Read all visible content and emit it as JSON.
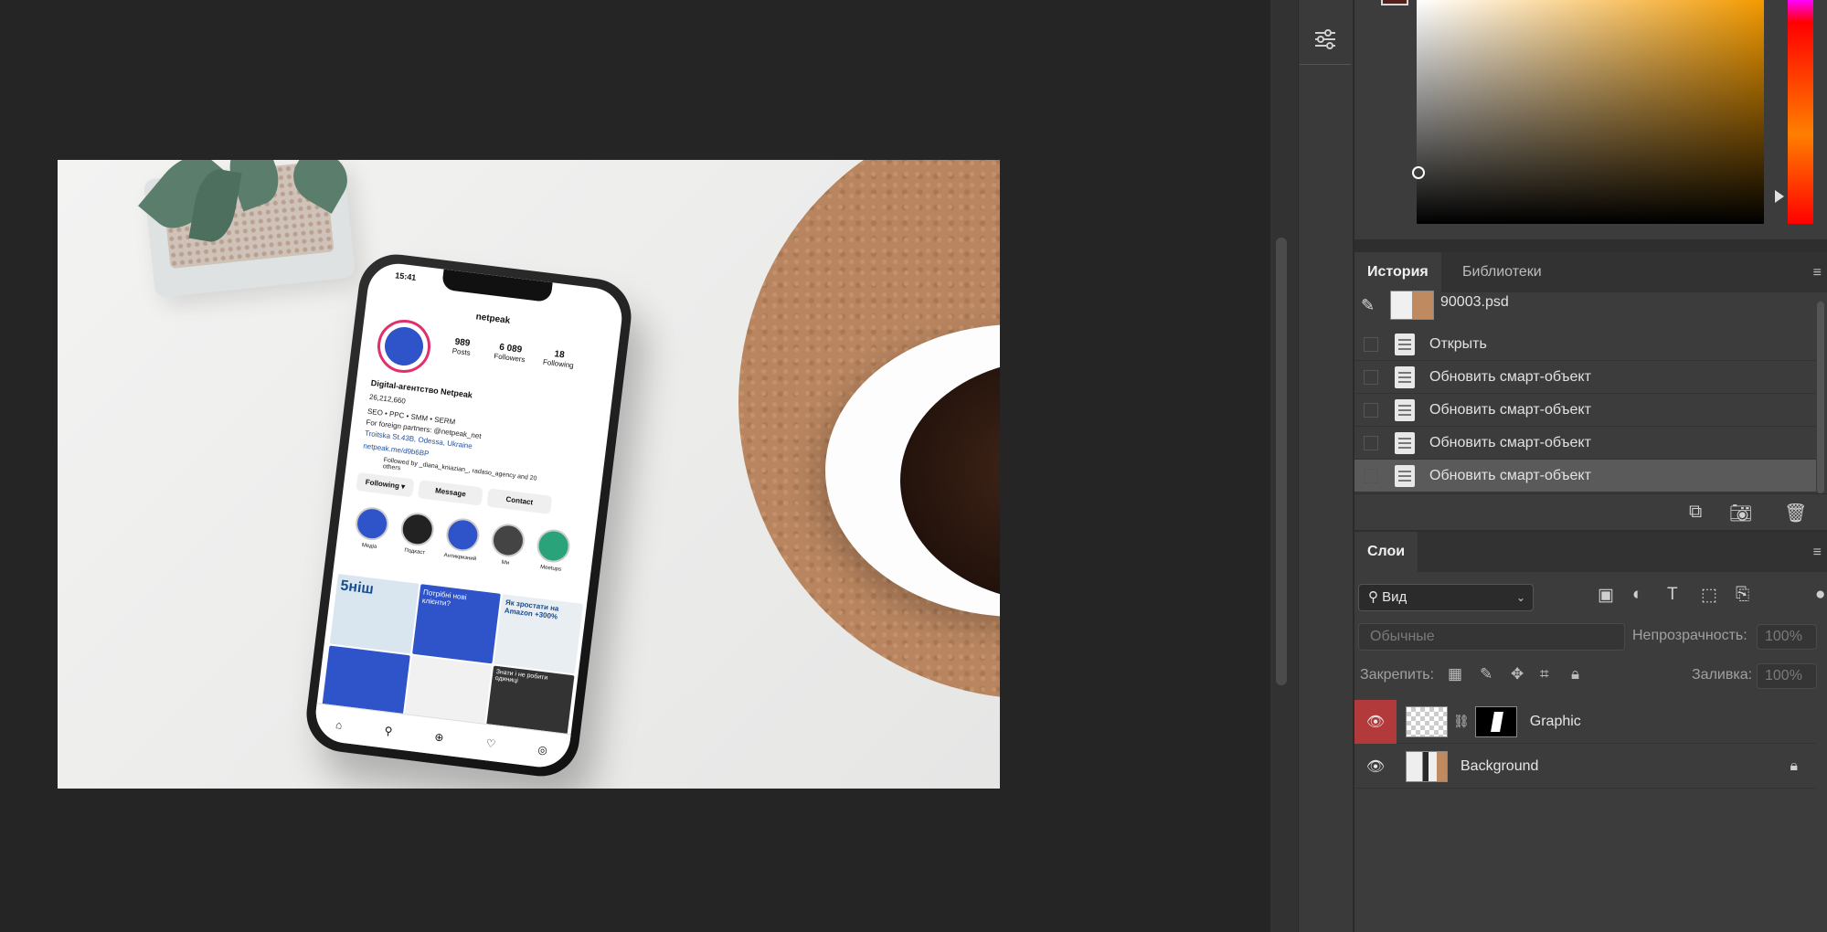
{
  "canvas": {
    "phone": {
      "time": "15:41",
      "username": "netpeak",
      "posts": {
        "value": "989",
        "label": "Posts"
      },
      "followers": {
        "value": "6 089",
        "label": "Followers"
      },
      "following": {
        "value": "18",
        "label": "Following"
      },
      "display_name": "Digital-агентство Netpeak",
      "threads_badge": "26,212,660",
      "bio_line1": "SEO • PPC • SMM • SERM",
      "bio_line2": "For foreign partners: @netpeak_net",
      "bio_line3": "Troitska St.43B, Odessa, Ukraine",
      "bio_link": "netpeak.me/d9b6BP",
      "followed_by": "Followed by _diana_kniazian_, radaso_agency and 20 others",
      "btn_following": "Following ▾",
      "btn_message": "Message",
      "btn_contact": "Contact",
      "highlights": [
        "Медіа",
        "Подкаст",
        "Антикризний",
        "Ми",
        "Meetups"
      ],
      "post1": "5ніш",
      "post2": "Потрібні нові клієнти?",
      "post3": "Як зростати на Amazon +300%",
      "post4": "Знати і не робити",
      "post5": "одиниці"
    }
  },
  "toolbar": {
    "adjust_icon": "sliders-icon"
  },
  "history_panel": {
    "tabs": [
      {
        "label": "История",
        "active": true
      },
      {
        "label": "Библиотеки",
        "active": false
      }
    ],
    "snapshot": "90003.psd",
    "items": [
      {
        "label": "Открыть"
      },
      {
        "label": "Обновить смарт-объект"
      },
      {
        "label": "Обновить смарт-объект"
      },
      {
        "label": "Обновить смарт-объект"
      },
      {
        "label": "Обновить смарт-объект",
        "selected": true
      }
    ]
  },
  "layers_panel": {
    "tab": "Слои",
    "search_kind": "Вид",
    "blend_mode": "Обычные",
    "opacity_label": "Непрозрачность:",
    "opacity_value": "100%",
    "lock_label": "Закрепить:",
    "fill_label": "Заливка:",
    "fill_value": "100%",
    "layers": [
      {
        "name": "Graphic",
        "visible": true,
        "selected": true
      },
      {
        "name": "Background",
        "visible": true,
        "locked": true
      }
    ]
  },
  "colors": {
    "foreground": "#552019",
    "picker_hue": "#f39a00",
    "eye_active": "#b33a3a"
  }
}
